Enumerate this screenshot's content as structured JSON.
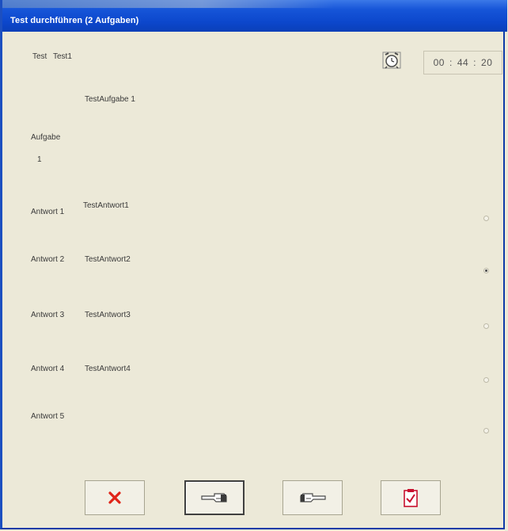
{
  "window": {
    "title": "Test durchführen (2 Aufgaben)"
  },
  "test": {
    "label": "Test",
    "name": "Test1"
  },
  "timer": {
    "hours": "00",
    "minutes": "44",
    "seconds": "20",
    "separator": ":"
  },
  "task": {
    "title": "TestAufgabe 1",
    "label": "Aufgabe",
    "number": "1"
  },
  "answers": [
    {
      "label": "Antwort 1",
      "text": "TestAntwort1",
      "selected": false
    },
    {
      "label": "Antwort 2",
      "text": "TestAntwort2",
      "selected": true
    },
    {
      "label": "Antwort 3",
      "text": "TestAntwort3",
      "selected": false
    },
    {
      "label": "Antwort 4",
      "text": "TestAntwort4",
      "selected": false
    },
    {
      "label": "Antwort 5",
      "text": "",
      "selected": false
    }
  ],
  "buttons": [
    {
      "name": "cancel-button",
      "icon": "close-x-icon",
      "color": "#e02418"
    },
    {
      "name": "previous-button",
      "icon": "hand-pointing-left-icon",
      "color": "#5a5a5a"
    },
    {
      "name": "next-button",
      "icon": "hand-pointing-right-icon",
      "color": "#5a5a5a"
    },
    {
      "name": "finish-button",
      "icon": "clipboard-check-icon",
      "color": "#c8102e"
    }
  ],
  "colors": {
    "titlebar": "#0c47cc",
    "background": "#ECE9D8",
    "cancel": "#e02418"
  }
}
